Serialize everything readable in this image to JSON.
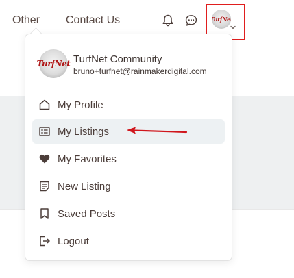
{
  "nav": {
    "links": [
      "Other",
      "Contact Us"
    ]
  },
  "header": {
    "avatar_text": "TurfNet",
    "notification_icon": "bell-icon",
    "messages_icon": "chat-icon"
  },
  "dropdown": {
    "community_name": "TurfNet Community",
    "email": "bruno+turfnet@rainmakerdigital.com",
    "avatar_text": "TurfNet",
    "items": [
      {
        "label": "My Profile",
        "icon": "home-icon"
      },
      {
        "label": "My Listings",
        "icon": "list-card-icon",
        "active": true
      },
      {
        "label": "My Favorites",
        "icon": "heart-icon"
      },
      {
        "label": "New Listing",
        "icon": "note-icon"
      },
      {
        "label": "Saved Posts",
        "icon": "bookmark-icon"
      },
      {
        "label": "Logout",
        "icon": "logout-icon"
      }
    ]
  },
  "colors": {
    "highlight_border": "#e01e1e",
    "annotation_arrow": "#d0161c",
    "active_item_bg": "#edf1f3",
    "text": "#4b3d39"
  }
}
